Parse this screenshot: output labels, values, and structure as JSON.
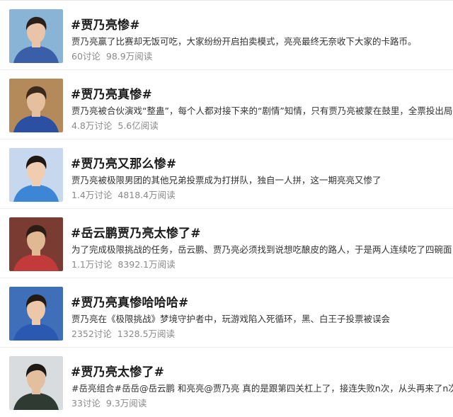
{
  "topics": [
    {
      "title": "#贾乃亮惨#",
      "desc": "贾乃亮赢了比赛却无饭可吃，大家纷纷开启拍卖模式，亮亮最终无奈收下大家的卡路币。",
      "discuss": "60讨论",
      "reads": "98.9万阅读",
      "thumb": {
        "bg": "#8ab4d6",
        "skin": "#e9c4a8",
        "hair": "#2a1f1a",
        "shirt": "#3a5fa8"
      }
    },
    {
      "title": "#贾乃亮真惨#",
      "desc": "贾乃亮被合伙演戏“整蛊”，每个人都对接下来的“剧情”知情，只有贾乃亮被蒙在鼓里，全票投出局某",
      "discuss": "4.8万讨论",
      "reads": "5.6亿阅读",
      "thumb": {
        "bg": "#b48a5a",
        "skin": "#e6bf9f",
        "hair": "#3b2a1c",
        "shirt": "#2a4fa3"
      }
    },
    {
      "title": "#贾乃亮又那么惨#",
      "desc": "贾乃亮被极限男团的其他兄弟投票成为打拼队，独自一人拼，这一期亮亮又惨了",
      "discuss": "1.4万讨论",
      "reads": "4818.4万阅读",
      "thumb": {
        "bg": "#c7d8ee",
        "skin": "#f0cdb0",
        "hair": "#1e1713",
        "shirt": "#3d86d6"
      }
    },
    {
      "title": "#岳云鹏贾乃亮太惨了#",
      "desc": "为了完成极限挑战的任务，岳云鹏、贾乃亮必须找到说想吃酿皮的路人，于是两人连续吃了四碗面",
      "discuss": "1.1万讨论",
      "reads": "8392.1万阅读",
      "thumb": {
        "bg": "#7a3b32",
        "skin": "#e0b894",
        "hair": "#2b1d16",
        "shirt": "#c33a3a"
      }
    },
    {
      "title": "#贾乃亮真惨哈哈哈#",
      "desc": "贾乃亮在《极限挑战》梦境守护者中，玩游戏陷入死循环，黑、白王子投票被误会",
      "discuss": "2352讨论",
      "reads": "1328.5万阅读",
      "thumb": {
        "bg": "#3f6fb8",
        "skin": "#ecc7aa",
        "hair": "#241a14",
        "shirt": "#2b58b0"
      }
    },
    {
      "title": "#贾乃亮太惨了#",
      "desc": "#岳亮组合#岳岳@岳云鹏 和亮亮@贾乃亮 真的是跟第四关杠上了，接连失败n次，从头再来了n次，",
      "discuss": "33讨论",
      "reads": "9.3万阅读",
      "thumb": {
        "bg": "#d9dcdf",
        "skin": "#e4bf9f",
        "hair": "#1f1915",
        "shirt": "#2f3a33"
      }
    }
  ]
}
